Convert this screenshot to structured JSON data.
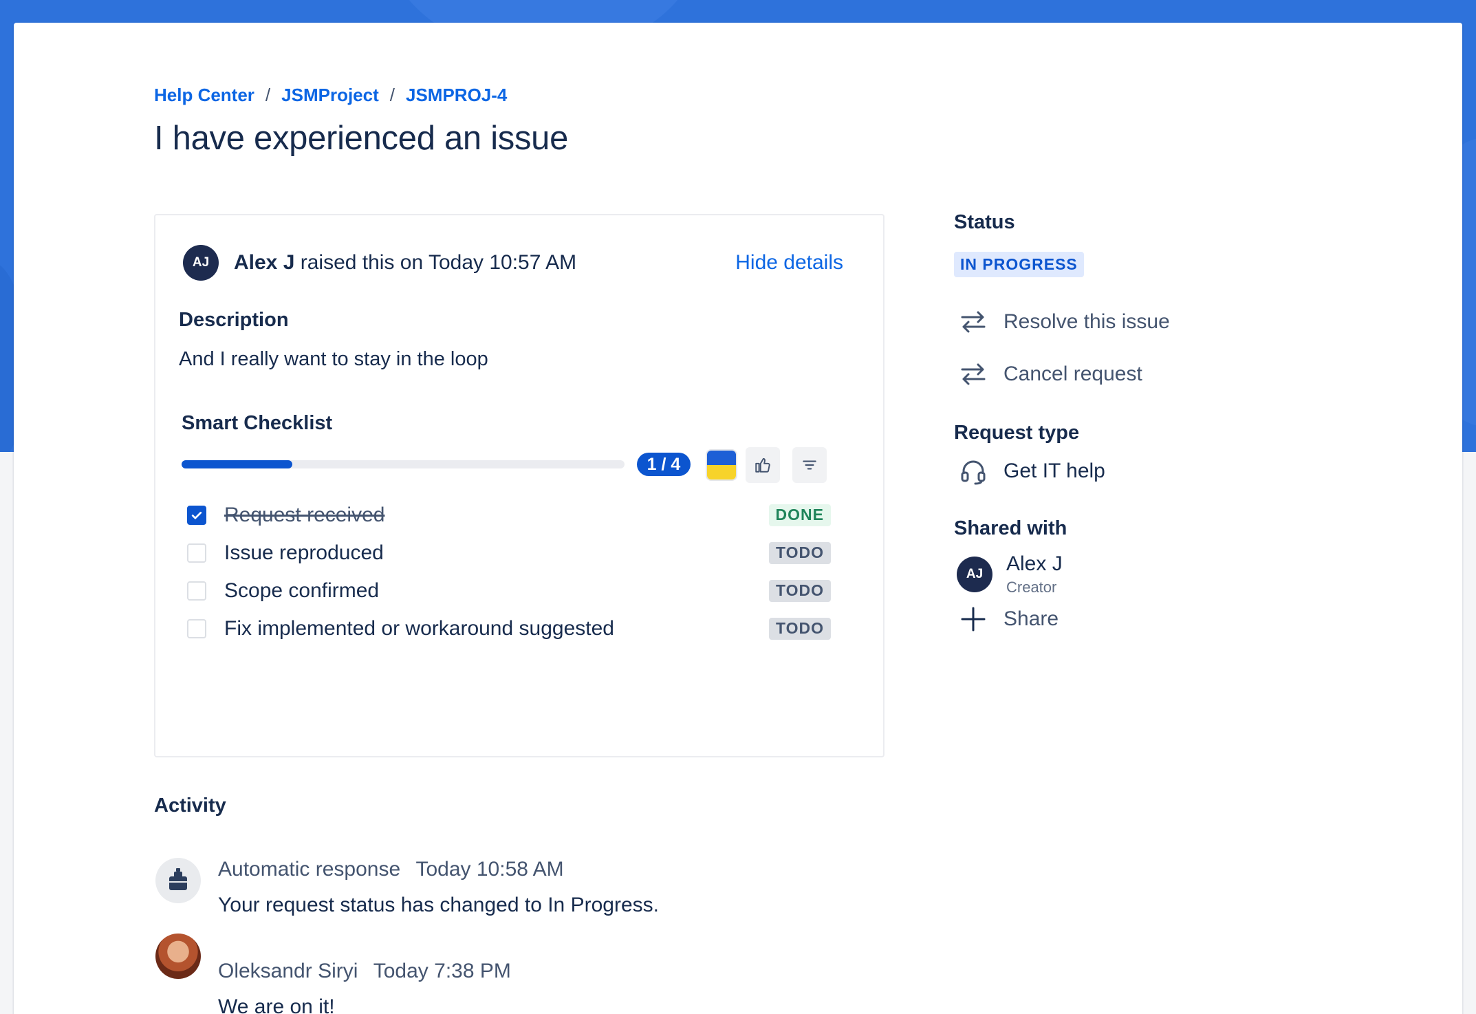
{
  "breadcrumb": {
    "items": [
      "Help Center",
      "JSMProject",
      "JSMPROJ-4"
    ],
    "separator": "/"
  },
  "title": "I have experienced an issue",
  "request": {
    "reporter_initials": "AJ",
    "reporter_name": "Alex J",
    "raised_text": "raised this on Today 10:57 AM",
    "hide_details": "Hide details",
    "description_label": "Description",
    "description": "And I really want to stay in the loop"
  },
  "checklist": {
    "title": "Smart Checklist",
    "progress": 0.25,
    "count": "1 / 4",
    "items": [
      {
        "label": "Request received",
        "checked": true,
        "status": "DONE"
      },
      {
        "label": "Issue reproduced",
        "checked": false,
        "status": "TODO"
      },
      {
        "label": "Scope confirmed",
        "checked": false,
        "status": "TODO"
      },
      {
        "label": "Fix implemented or workaround suggested",
        "checked": false,
        "status": "TODO"
      }
    ]
  },
  "sidebar": {
    "status_label": "Status",
    "status_value": "IN PROGRESS",
    "actions": [
      "Resolve this issue",
      "Cancel request"
    ],
    "request_type_label": "Request type",
    "request_type": "Get IT help",
    "shared_with_label": "Shared with",
    "shared_user_initials": "AJ",
    "shared_user_name": "Alex J",
    "shared_user_role": "Creator",
    "share_label": "Share"
  },
  "activity": {
    "title": "Activity",
    "entries": [
      {
        "author": "Automatic response",
        "time": "Today 10:58 AM",
        "body": "Your request status has changed to In Progress."
      },
      {
        "author": "Oleksandr Siryi",
        "time": "Today 7:38 PM",
        "body": "We are on it!"
      }
    ]
  },
  "colors": {
    "banner": "#2e72db",
    "link": "#0c66e4",
    "progress": "#0c55cf",
    "done_tag_bg": "#e6f7ed",
    "todo_tag_bg": "#dcdfe4"
  }
}
